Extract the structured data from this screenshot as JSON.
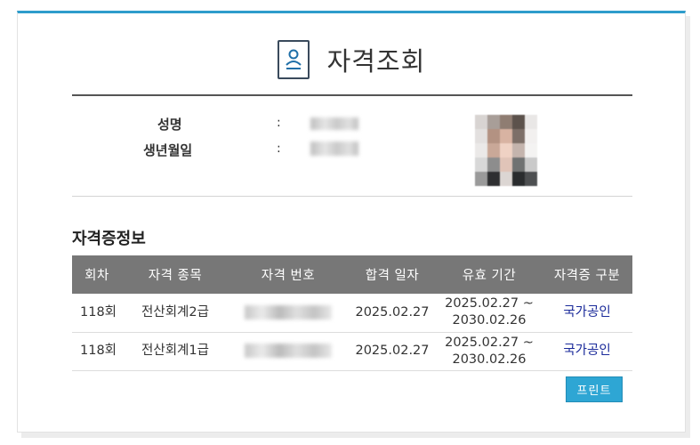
{
  "header": {
    "title": "자격조회"
  },
  "profile": {
    "name_label": "성명",
    "birth_label": "생년월일",
    "separator": ":"
  },
  "certificates": {
    "section_title": "자격증정보",
    "columns": [
      "회차",
      "자격 종목",
      "자격 번호",
      "합격 일자",
      "유효 기간",
      "자격증 구분"
    ],
    "rows": [
      {
        "round": "118회",
        "subject": "전산회계2급",
        "pass_date": "2025.02.27",
        "valid_from": "2025.02.27 ~",
        "valid_to": "2030.02.26",
        "type": "국가공인"
      },
      {
        "round": "118회",
        "subject": "전산회계1급",
        "pass_date": "2025.02.27",
        "valid_from": "2025.02.27 ~",
        "valid_to": "2030.02.26",
        "type": "국가공인"
      }
    ]
  },
  "actions": {
    "print_label": "프린트"
  },
  "colors": {
    "accent": "#2e9ccb",
    "header_bg": "#777777",
    "badge_text": "#1a2a9a",
    "button_bg": "#2ea6d4"
  },
  "icons": {
    "title_icon": "id-card-icon"
  }
}
